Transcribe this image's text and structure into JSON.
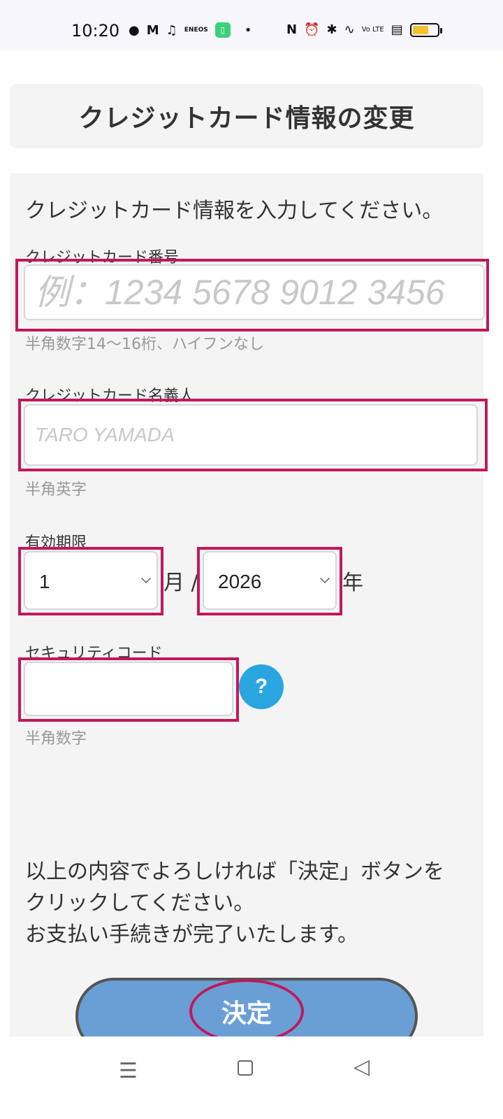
{
  "status_bar": {
    "time": "10:20",
    "left_icons": [
      "chat-icon",
      "mail-icon",
      "tiktok-icon",
      "eneos-icon",
      "app-icon",
      "dot-icon"
    ],
    "right_icons": [
      "nfc-icon",
      "alarm-icon",
      "bluetooth-icon",
      "wifi-icon",
      "volte-icon",
      "signal-icon",
      "battery-icon"
    ],
    "eneos_label": "ENEOS",
    "volte_label": "Vo LTE",
    "battery_level": 0.6
  },
  "page": {
    "title": "クレジットカード情報の変更",
    "intro": "クレジットカード情報を入力してください。"
  },
  "form": {
    "card_number": {
      "label": "クレジットカード番号",
      "placeholder": "例：1234 5678 9012 3456",
      "hint": "半角数字14〜16桁、ハイフンなし"
    },
    "card_holder": {
      "label": "クレジットカード名義人",
      "placeholder": "TARO YAMADA",
      "hint": "半角英字"
    },
    "expiry": {
      "label": "有効期限",
      "month_value": "1",
      "month_unit": "月 /",
      "year_value": "2026",
      "year_unit": "年"
    },
    "security_code": {
      "label": "セキュリティコード",
      "value": "",
      "hint": "半角数字",
      "help_label": "?"
    }
  },
  "confirm_text": {
    "line1": "以上の内容でよろしければ「決定」ボタンを",
    "line2": "クリックしてください。",
    "line3": "お支払い手続きが完了いたします。"
  },
  "submit_label": "決定",
  "highlight_color": "#c2185b",
  "accent_color": "#6a9fd6",
  "nav": {
    "menu_icon": "menu-icon",
    "home_icon": "home-icon",
    "back_icon": "back-icon"
  }
}
